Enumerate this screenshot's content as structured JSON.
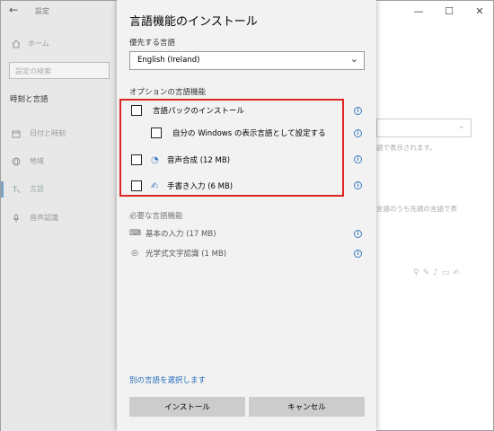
{
  "window": {
    "app_title": "設定",
    "back_glyph": "←",
    "minimize_glyph": "—",
    "maximize_glyph": "☐",
    "close_glyph": "✕"
  },
  "sidebar": {
    "home_label": "ホーム",
    "search_placeholder": "設定の検索",
    "section_label": "時刻と言語",
    "items": [
      {
        "label": "日付と時刻",
        "icon": "calendar-icon"
      },
      {
        "label": "地域",
        "icon": "globe-icon"
      },
      {
        "label": "言語",
        "icon": "language-icon"
      },
      {
        "label": "音声認識",
        "icon": "microphone-icon"
      }
    ]
  },
  "background": {
    "text_display": "語で表示されます。",
    "text_language_order": "言語のうち先頭の言語で表"
  },
  "dialog": {
    "title": "言語機能のインストール",
    "preferred_label": "優先する言語",
    "language_value": "English (Ireland)",
    "optional_label": "オプションの言語機能",
    "options": {
      "lang_pack": "言語パックのインストール",
      "set_display": "自分の Windows の表示言語として設定する",
      "tts": "音声合成 (12 MB)",
      "handwriting": "手書き入力 (6 MB)"
    },
    "info_glyph": "i",
    "required_label": "必要な言語機能",
    "required": {
      "basic_typing": "基本の入力 (17 MB)",
      "ocr": "光学式文字認識 (1 MB)"
    },
    "choose_other_link": "別の言語を選択します",
    "install_button": "インストール",
    "cancel_button": "キャンセル"
  },
  "colors": {
    "highlight_frame": "#e02424",
    "link": "#2a6ebb",
    "info_icon": "#3c7dc4"
  }
}
